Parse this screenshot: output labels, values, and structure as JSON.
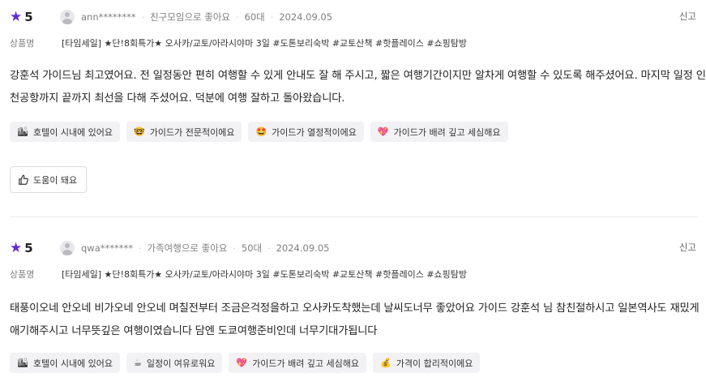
{
  "reviews": [
    {
      "rating": "5",
      "user": "ann********",
      "travel_type": "친구모임으로 좋아요",
      "age": "60대",
      "date": "2024.09.05",
      "report_label": "신고",
      "product_label": "상품명",
      "product_name": "[타임세일] ★단!8회특가★ 오사카/교토/아라시야마 3일 #도톤보리숙박 #교토산책 #핫플레이스 #쇼핑탐방",
      "body_lines": [
        "강훈석 가이드님 최고였어요. 전 일정동안 편히 여행할 수 있게 안내도 잘 해 주시고, 짧은 여행기간이지만 알차게 여행할 수 있도록 해주셨어요. 마지막 일정 인",
        "천공항까지 끝까지 최선을 다해 주셨어요. 덕분에 여행 잘하고 돌아왔습니다."
      ],
      "tags": [
        {
          "icon": "city-icon",
          "glyph": "🏙",
          "label": "호텔이 시내에 있어요"
        },
        {
          "icon": "nerd-face-icon",
          "glyph": "🤓",
          "label": "가이드가 전문적이에요"
        },
        {
          "icon": "star-struck-icon",
          "glyph": "🤩",
          "label": "가이드가 열정적이에요"
        },
        {
          "icon": "sparkling-heart-icon",
          "glyph": "💖",
          "label": "가이드가 배려 깊고 세심해요"
        }
      ],
      "helpful_label": "도움이 돼요"
    },
    {
      "rating": "5",
      "user": "qwa*******",
      "travel_type": "가족여행으로 좋아요",
      "age": "50대",
      "date": "2024.09.05",
      "report_label": "신고",
      "product_label": "상품명",
      "product_name": "[타임세일] ★단!8회특가★ 오사카/교토/아라시야마 3일 #도톤보리숙박 #교토산책 #핫플레이스 #쇼핑탐방",
      "body_lines": [
        "태풍이오네 안오네 비가오네 안오네 며칠전부터 조금은걱정을하고 오사카도착했는데 날씨도너무 좋았어요 가이드 강훈석 님 참친절하시고 일본역사도 재밌게",
        "애기해주시고 너무뜻깊은 여행이였습니다 담엔 도쿄여행준비인데 너무기대가됩니다"
      ],
      "tags": [
        {
          "icon": "city-icon",
          "glyph": "🏙",
          "label": "호텔이 시내에 있어요"
        },
        {
          "icon": "coffee-icon",
          "glyph": "☕",
          "label": "일정이 여유로워요"
        },
        {
          "icon": "sparkling-heart-icon",
          "glyph": "💖",
          "label": "가이드가 배려 깊고 세심해요"
        },
        {
          "icon": "money-bag-icon",
          "glyph": "💰",
          "label": "가격이 합리적이에요"
        }
      ]
    }
  ],
  "colors": {
    "star": "#5b2fd1",
    "meta": "#808080",
    "tag_bg": "#f2f2f4"
  }
}
